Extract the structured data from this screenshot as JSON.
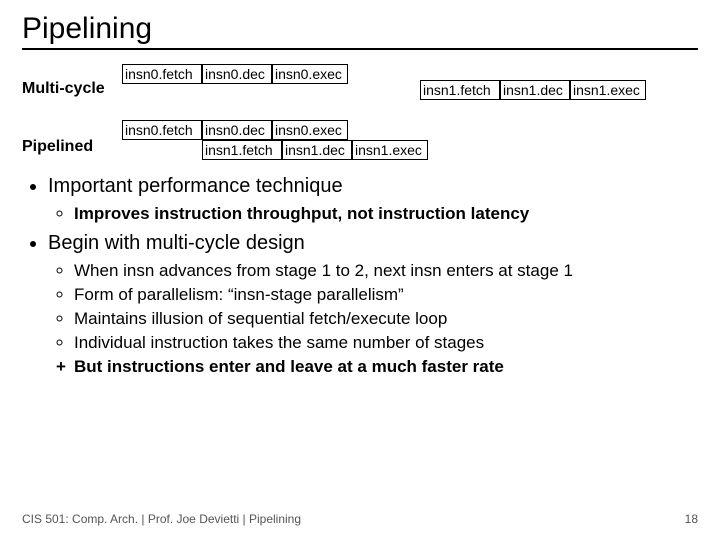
{
  "title": "Pipelining",
  "diagrams": {
    "multicycle": {
      "label": "Multi-cycle",
      "row0": [
        "insn0.fetch",
        "insn0.dec",
        "insn0.exec"
      ],
      "row1": [
        "insn1.fetch",
        "insn1.dec",
        "insn1.exec"
      ]
    },
    "pipelined": {
      "label": "Pipelined",
      "row0": [
        "insn0.fetch",
        "insn0.dec",
        "insn0.exec"
      ],
      "row1": [
        "insn1.fetch",
        "insn1.dec",
        "insn1.exec"
      ]
    }
  },
  "bullets": {
    "b1": "Important performance technique",
    "b1_1": "Improves instruction throughput, not instruction latency",
    "b2": "Begin with multi-cycle design",
    "b2_1": "When insn advances from stage 1 to 2, next insn enters at stage 1",
    "b2_2": "Form of parallelism: “insn-stage parallelism”",
    "b2_3": "Maintains illusion of sequential fetch/execute loop",
    "b2_4": "Individual instruction takes the same number of stages",
    "b2_5": "But instructions enter and leave at a much faster rate"
  },
  "footer_left": "CIS 501: Comp. Arch.  |  Prof. Joe Devietti  |  Pipelining",
  "footer_right": "18"
}
